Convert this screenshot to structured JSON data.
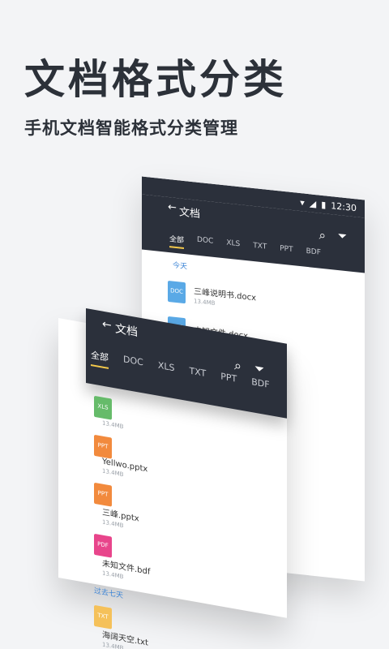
{
  "headline": "文档格式分类",
  "subheadline": "手机文档智能格式分类管理",
  "colors": {
    "toolbar": "#2b303b",
    "tab_indicator": "#f3c84b",
    "doc": "#5aa9e6",
    "ppt": "#f28a3d",
    "pdf": "#e8458b",
    "txt": "#f5c15a",
    "green": "#66bb6a"
  },
  "back_card": {
    "status_time": "12:30",
    "title": "文档",
    "tabs": [
      "全部",
      "DOC",
      "XLS",
      "TXT",
      "PPT",
      "BDF"
    ],
    "today_label": "今天",
    "files": [
      {
        "icon": "DOC",
        "name": "三峰说明书.docx",
        "size": "13.4MB"
      },
      {
        "icon": "DOC",
        "name": "未知文件.docx",
        "size": ""
      }
    ]
  },
  "front_card": {
    "title": "文档",
    "tabs": [
      "全部",
      "DOC",
      "XLS",
      "TXT",
      "PPT",
      "BDF"
    ],
    "files": [
      {
        "icon": "XLS",
        "name": "",
        "size": "13.4MB"
      },
      {
        "icon": "PPT",
        "name": "Yellwo.pptx",
        "size": "13.4MB"
      },
      {
        "icon": "PPT",
        "name": "三峰.pptx",
        "size": "13.4MB"
      },
      {
        "icon": "PDF",
        "name": "未知文件.bdf",
        "size": "13.4MB"
      }
    ],
    "last_seven_days_label": "过去七天",
    "older_files": [
      {
        "icon": "TXT",
        "name": "海阔天空.txt",
        "size": "13.4MB"
      }
    ]
  }
}
